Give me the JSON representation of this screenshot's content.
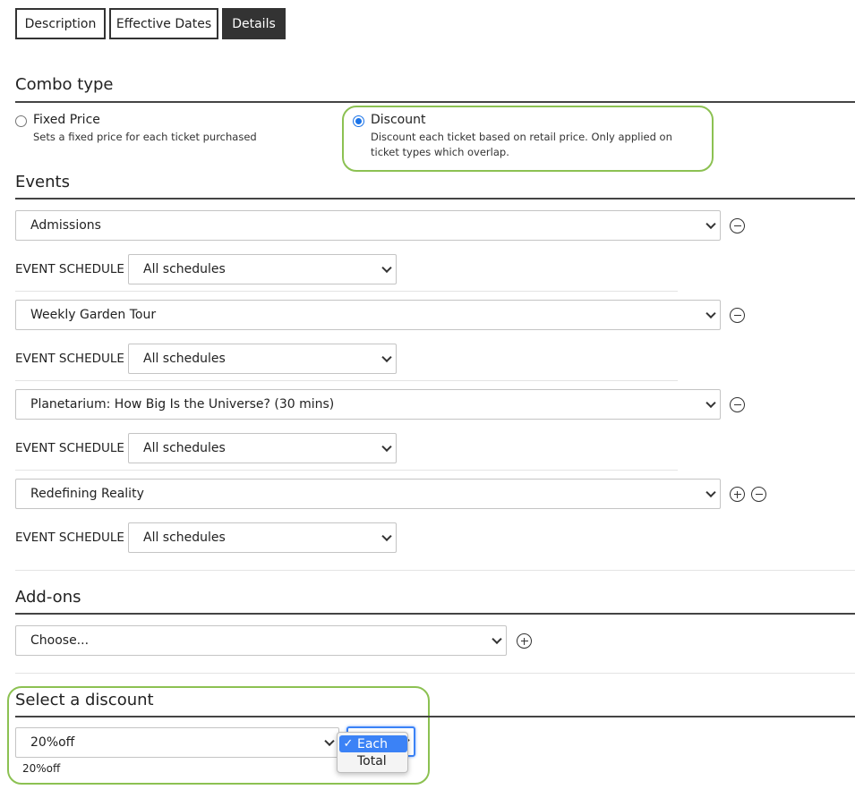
{
  "tabs": [
    {
      "label": "Description",
      "active": false
    },
    {
      "label": "Effective Dates",
      "active": false
    },
    {
      "label": "Details",
      "active": true
    }
  ],
  "combo_type": {
    "title": "Combo type",
    "options": [
      {
        "label": "Fixed Price",
        "description": "Sets a fixed price for each ticket purchased",
        "selected": false
      },
      {
        "label": "Discount",
        "description_line1": "Discount each ticket based on retail price. Only applied on",
        "description_line2": "ticket types which overlap.",
        "selected": true
      }
    ]
  },
  "events": {
    "title": "Events",
    "schedule_label": "EVENT SCHEDULE",
    "items": [
      {
        "event": "Admissions",
        "schedule": "All schedules"
      },
      {
        "event": "Weekly Garden Tour",
        "schedule": "All schedules"
      },
      {
        "event": "Planetarium: How Big Is the Universe? (30 mins)",
        "schedule": "All schedules"
      },
      {
        "event": "Redefining Reality",
        "schedule": "All schedules"
      }
    ]
  },
  "addons": {
    "title": "Add-ons",
    "select_value": "Choose..."
  },
  "discount": {
    "title": "Select a discount",
    "select_value": "20%off",
    "caption": "20%off",
    "unit_options": [
      "Each",
      "Total"
    ],
    "unit_selected": "Each",
    "check_glyph": "✓"
  },
  "colors": {
    "highlight": "#8cc152",
    "accent": "#3b82f6",
    "tab_active": "#333333"
  }
}
